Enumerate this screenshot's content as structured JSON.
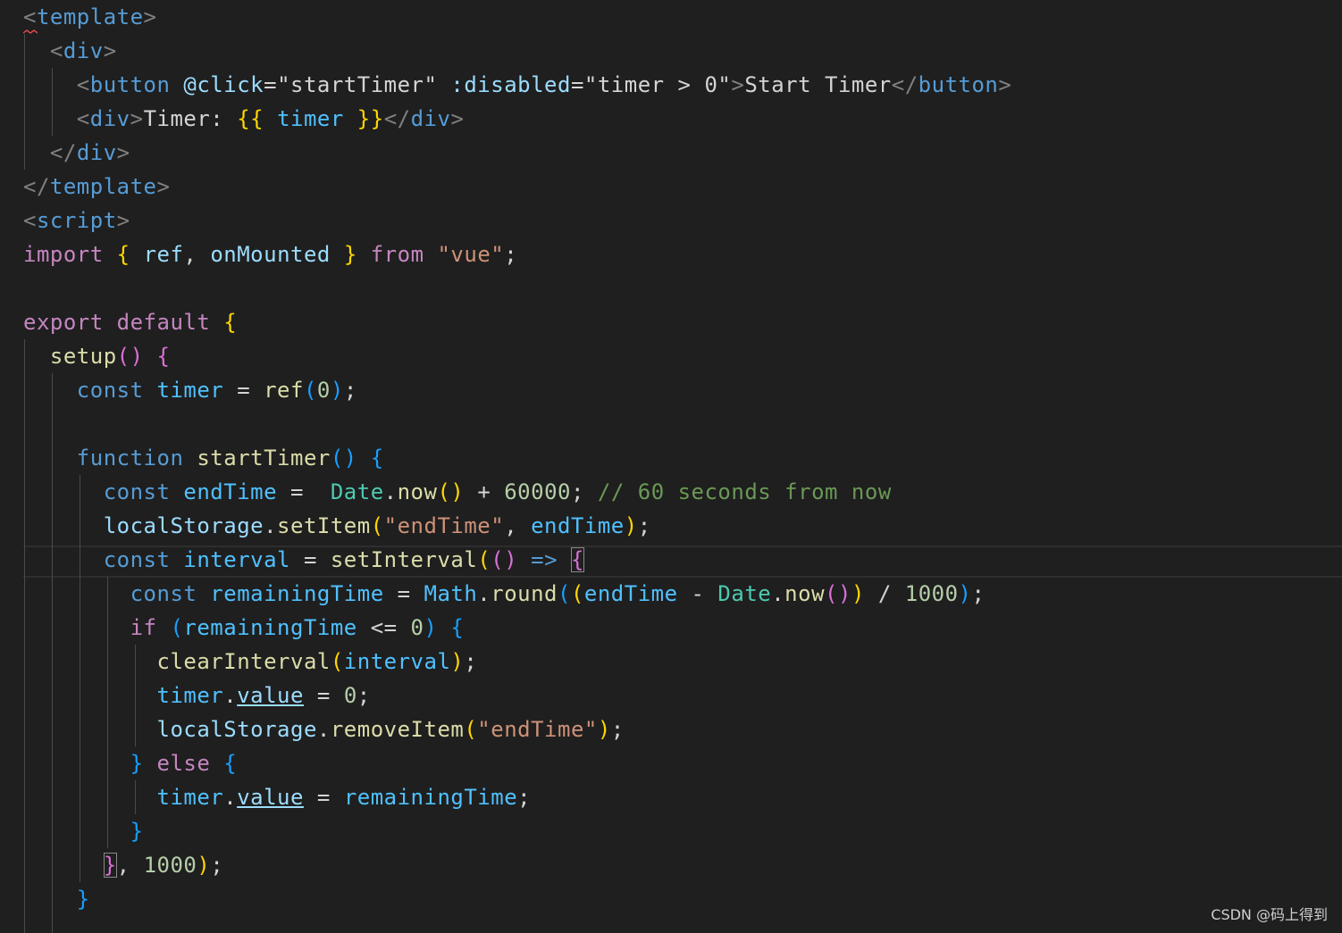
{
  "editor": {
    "theme": "dark",
    "background": "#1f1f1f",
    "lines": [
      [
        [
          "<",
          "c-tag"
        ],
        [
          "template",
          "c-tagn"
        ],
        [
          ">",
          "c-tag"
        ]
      ],
      [
        [
          "  ",
          ""
        ],
        [
          "<",
          "c-tag"
        ],
        [
          "div",
          "c-tagn"
        ],
        [
          ">",
          "c-tag"
        ]
      ],
      [
        [
          "    ",
          ""
        ],
        [
          "<",
          "c-tag"
        ],
        [
          "button",
          "c-tagn"
        ],
        [
          " ",
          ""
        ],
        [
          "@click",
          "c-attr"
        ],
        [
          "=",
          "c-txt"
        ],
        [
          "\"startTimer\"",
          "c-txt"
        ],
        [
          " ",
          ""
        ],
        [
          ":disabled",
          "c-attr"
        ],
        [
          "=",
          "c-txt"
        ],
        [
          "\"timer > 0\"",
          "c-txt"
        ],
        [
          ">",
          "c-tag"
        ],
        [
          "Start Timer",
          "c-txt"
        ],
        [
          "</",
          "c-tag"
        ],
        [
          "button",
          "c-tagn"
        ],
        [
          ">",
          "c-tag"
        ]
      ],
      [
        [
          "    ",
          ""
        ],
        [
          "<",
          "c-tag"
        ],
        [
          "div",
          "c-tagn"
        ],
        [
          ">",
          "c-tag"
        ],
        [
          "Timer: ",
          "c-txt"
        ],
        [
          "{{",
          "c-b1"
        ],
        [
          " ",
          ""
        ],
        [
          "timer",
          "c-var"
        ],
        [
          " ",
          ""
        ],
        [
          "}}",
          "c-b1"
        ],
        [
          "</",
          "c-tag"
        ],
        [
          "div",
          "c-tagn"
        ],
        [
          ">",
          "c-tag"
        ]
      ],
      [
        [
          "  ",
          ""
        ],
        [
          "</",
          "c-tag"
        ],
        [
          "div",
          "c-tagn"
        ],
        [
          ">",
          "c-tag"
        ]
      ],
      [
        [
          "</",
          "c-tag"
        ],
        [
          "template",
          "c-tagn"
        ],
        [
          ">",
          "c-tag"
        ]
      ],
      [
        [
          "<",
          "c-tag"
        ],
        [
          "script",
          "c-tagn"
        ],
        [
          ">",
          "c-tag"
        ]
      ],
      [
        [
          "import",
          "c-kw"
        ],
        [
          " ",
          ""
        ],
        [
          "{",
          "c-b1"
        ],
        [
          " ",
          ""
        ],
        [
          "ref",
          "c-param"
        ],
        [
          ", ",
          "c-txt"
        ],
        [
          "onMounted",
          "c-param"
        ],
        [
          " ",
          ""
        ],
        [
          "}",
          "c-b1"
        ],
        [
          " ",
          ""
        ],
        [
          "from",
          "c-kw"
        ],
        [
          " ",
          ""
        ],
        [
          "\"vue\"",
          "c-str"
        ],
        [
          ";",
          "c-txt"
        ]
      ],
      [],
      [
        [
          "export",
          "c-kw"
        ],
        [
          " ",
          ""
        ],
        [
          "default",
          "c-kw"
        ],
        [
          " ",
          ""
        ],
        [
          "{",
          "c-b1"
        ]
      ],
      [
        [
          "  ",
          ""
        ],
        [
          "setup",
          "c-fn"
        ],
        [
          "()",
          "c-b2"
        ],
        [
          " ",
          ""
        ],
        [
          "{",
          "c-b2"
        ]
      ],
      [
        [
          "    ",
          ""
        ],
        [
          "const",
          "c-decl"
        ],
        [
          " ",
          ""
        ],
        [
          "timer",
          "c-var"
        ],
        [
          " = ",
          "c-txt"
        ],
        [
          "ref",
          "c-fn"
        ],
        [
          "(",
          "c-b3"
        ],
        [
          "0",
          "c-num"
        ],
        [
          ")",
          "c-b3"
        ],
        [
          ";",
          "c-txt"
        ]
      ],
      [],
      [
        [
          "    ",
          ""
        ],
        [
          "function",
          "c-decl"
        ],
        [
          " ",
          ""
        ],
        [
          "startTimer",
          "c-fn"
        ],
        [
          "()",
          "c-b3"
        ],
        [
          " ",
          ""
        ],
        [
          "{",
          "c-b3"
        ]
      ],
      [
        [
          "      ",
          ""
        ],
        [
          "const",
          "c-decl"
        ],
        [
          " ",
          ""
        ],
        [
          "endTime",
          "c-var"
        ],
        [
          " =  ",
          "c-txt"
        ],
        [
          "Date",
          "c-cls"
        ],
        [
          ".",
          "c-txt"
        ],
        [
          "now",
          "c-fn"
        ],
        [
          "()",
          "c-b1"
        ],
        [
          " + ",
          "c-txt"
        ],
        [
          "60000",
          "c-num"
        ],
        [
          "; ",
          "c-txt"
        ],
        [
          "// 60 seconds from now",
          "c-com"
        ]
      ],
      [
        [
          "      ",
          ""
        ],
        [
          "localStorage",
          "c-param"
        ],
        [
          ".",
          "c-txt"
        ],
        [
          "setItem",
          "c-fn"
        ],
        [
          "(",
          "c-b1"
        ],
        [
          "\"endTime\"",
          "c-str"
        ],
        [
          ", ",
          "c-txt"
        ],
        [
          "endTime",
          "c-var"
        ],
        [
          ")",
          "c-b1"
        ],
        [
          ";",
          "c-txt"
        ]
      ],
      [
        [
          "      ",
          ""
        ],
        [
          "const",
          "c-decl"
        ],
        [
          " ",
          ""
        ],
        [
          "interval",
          "c-var"
        ],
        [
          " = ",
          "c-txt"
        ],
        [
          "setInterval",
          "c-fn"
        ],
        [
          "(",
          "c-b1"
        ],
        [
          "()",
          "c-b2"
        ],
        [
          " ",
          ""
        ],
        [
          "=>",
          "c-decl"
        ],
        [
          " ",
          ""
        ],
        [
          "{",
          "c-b2 bm"
        ]
      ],
      [
        [
          "        ",
          ""
        ],
        [
          "const",
          "c-decl"
        ],
        [
          " ",
          ""
        ],
        [
          "remainingTime",
          "c-var"
        ],
        [
          " = ",
          "c-txt"
        ],
        [
          "Math",
          "c-var"
        ],
        [
          ".",
          "c-txt"
        ],
        [
          "round",
          "c-fn"
        ],
        [
          "(",
          "c-b3"
        ],
        [
          "(",
          "c-b1"
        ],
        [
          "endTime",
          "c-var"
        ],
        [
          " - ",
          "c-txt"
        ],
        [
          "Date",
          "c-cls"
        ],
        [
          ".",
          "c-txt"
        ],
        [
          "now",
          "c-fn"
        ],
        [
          "(",
          "c-b2"
        ],
        [
          ")",
          "c-b2"
        ],
        [
          ")",
          "c-b1"
        ],
        [
          " / ",
          "c-txt"
        ],
        [
          "1000",
          "c-num"
        ],
        [
          ")",
          "c-b3"
        ],
        [
          ";",
          "c-txt"
        ]
      ],
      [
        [
          "        ",
          ""
        ],
        [
          "if",
          "c-kw"
        ],
        [
          " ",
          ""
        ],
        [
          "(",
          "c-b3"
        ],
        [
          "remainingTime",
          "c-var"
        ],
        [
          " <= ",
          "c-txt"
        ],
        [
          "0",
          "c-num"
        ],
        [
          ")",
          "c-b3"
        ],
        [
          " ",
          ""
        ],
        [
          "{",
          "c-b3"
        ]
      ],
      [
        [
          "          ",
          ""
        ],
        [
          "clearInterval",
          "c-fn"
        ],
        [
          "(",
          "c-b1"
        ],
        [
          "interval",
          "c-var"
        ],
        [
          ")",
          "c-b1"
        ],
        [
          ";",
          "c-txt"
        ]
      ],
      [
        [
          "          ",
          ""
        ],
        [
          "timer",
          "c-var"
        ],
        [
          ".",
          "c-txt"
        ],
        [
          "value",
          "c-param u"
        ],
        [
          " = ",
          "c-txt"
        ],
        [
          "0",
          "c-num"
        ],
        [
          ";",
          "c-txt"
        ]
      ],
      [
        [
          "          ",
          ""
        ],
        [
          "localStorage",
          "c-param"
        ],
        [
          ".",
          "c-txt"
        ],
        [
          "removeItem",
          "c-fn"
        ],
        [
          "(",
          "c-b1"
        ],
        [
          "\"endTime\"",
          "c-str"
        ],
        [
          ")",
          "c-b1"
        ],
        [
          ";",
          "c-txt"
        ]
      ],
      [
        [
          "        ",
          ""
        ],
        [
          "}",
          "c-b3"
        ],
        [
          " ",
          ""
        ],
        [
          "else",
          "c-kw"
        ],
        [
          " ",
          ""
        ],
        [
          "{",
          "c-b3"
        ]
      ],
      [
        [
          "          ",
          ""
        ],
        [
          "timer",
          "c-var"
        ],
        [
          ".",
          "c-txt"
        ],
        [
          "value",
          "c-param u"
        ],
        [
          " = ",
          "c-txt"
        ],
        [
          "remainingTime",
          "c-var"
        ],
        [
          ";",
          "c-txt"
        ]
      ],
      [
        [
          "        ",
          ""
        ],
        [
          "}",
          "c-b3"
        ]
      ],
      [
        [
          "      ",
          ""
        ],
        [
          "}",
          "c-b2 bm"
        ],
        [
          ", ",
          "c-txt"
        ],
        [
          "1000",
          "c-num"
        ],
        [
          ")",
          "c-b1"
        ],
        [
          ";",
          "c-txt"
        ]
      ],
      [
        [
          "    ",
          ""
        ],
        [
          "}",
          "c-b3"
        ]
      ]
    ]
  },
  "watermark": "CSDN @码上得到"
}
